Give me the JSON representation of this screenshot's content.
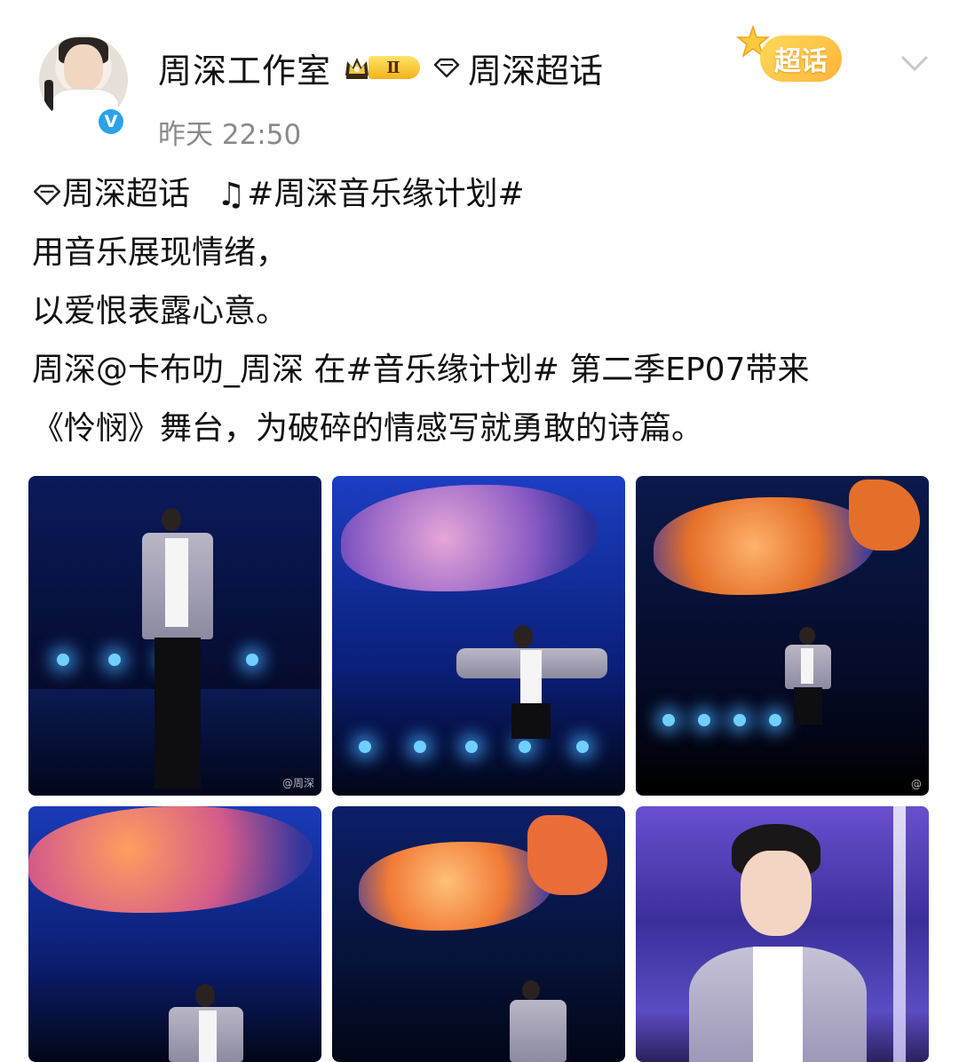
{
  "post": {
    "author": "周深工作室",
    "level_badge": "Ⅱ",
    "topic_label": "周深超话",
    "time": "昨天 22:50",
    "super_badge": "超话",
    "verified_mark": "V"
  },
  "content": {
    "line1_topic": "周深超话",
    "line1_music_icon": "♫",
    "line1_hashtag": "#周深音乐缘计划#",
    "line2": "用音乐展现情绪，",
    "line3": "以爱恨表露心意。",
    "line4": "周深@卡布叻_周深 在#音乐缘计划# 第二季EP07带来",
    "line5": "《怜悯》舞台，为破碎的情感写就勇敢的诗篇。"
  },
  "images": [
    {
      "name": "stage-photo-1",
      "description_icon": "performer-on-stage",
      "watermark": "@周深"
    },
    {
      "name": "stage-photo-2",
      "description_icon": "performer-arms-open",
      "watermark": ""
    },
    {
      "name": "stage-photo-3",
      "description_icon": "fish-sculpture-stage",
      "watermark": "@"
    },
    {
      "name": "stage-photo-4",
      "description_icon": "performer-singing",
      "watermark": ""
    },
    {
      "name": "stage-photo-5",
      "description_icon": "performer-pointing",
      "watermark": ""
    },
    {
      "name": "stage-photo-6",
      "description_icon": "performer-closeup",
      "watermark": ""
    }
  ],
  "colors": {
    "verified": "#2aa3ea",
    "badge_gold": "#f2b318",
    "time_gray": "#8a8a8a"
  }
}
